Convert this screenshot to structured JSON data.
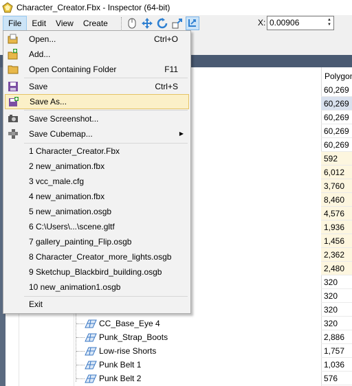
{
  "window": {
    "title": "Character_Creator.Fbx - Inspector (64-bit)"
  },
  "menubar": {
    "items": [
      {
        "label": "File",
        "open": true
      },
      {
        "label": "Edit"
      },
      {
        "label": "View"
      },
      {
        "label": "Create"
      }
    ]
  },
  "toolbar": {
    "x_label": "X:",
    "x_value": "0.00906",
    "icons": [
      "mouse-icon",
      "move-icon",
      "rotate-icon",
      "scale-icon",
      "snap-icon"
    ]
  },
  "file_menu": {
    "items": [
      {
        "label": "Open...",
        "shortcut": "Ctrl+O",
        "icon": "folder-open-icon"
      },
      {
        "label": "Add...",
        "shortcut": "",
        "icon": "add-file-icon"
      },
      {
        "label": "Open Containing Folder",
        "shortcut": "F11",
        "icon": "folder-icon"
      },
      {
        "label": "Save",
        "shortcut": "Ctrl+S",
        "icon": "save-icon"
      },
      {
        "label": "Save As...",
        "shortcut": "",
        "icon": "save-as-icon",
        "highlighted": true
      },
      {
        "label": "Save Screenshot...",
        "shortcut": "",
        "icon": "camera-icon"
      },
      {
        "label": "Save Cubemap...",
        "shortcut": "",
        "icon": "cubemap-icon",
        "submenu": true
      },
      {
        "label": "1 Character_Creator.Fbx"
      },
      {
        "label": "2 new_animation.fbx"
      },
      {
        "label": "3 vcc_male.cfg"
      },
      {
        "label": "4 new_animation.fbx"
      },
      {
        "label": "5 new_animation.osgb"
      },
      {
        "label": "6 C:\\Users\\...\\scene.gltf"
      },
      {
        "label": "7 gallery_painting_Flip.osgb"
      },
      {
        "label": "8 Character_Creator_more_lights.osgb"
      },
      {
        "label": "9 Sketchup_Blackbird_building.osgb"
      },
      {
        "label": "10 new_animation1.osgb"
      },
      {
        "label": "Exit"
      }
    ]
  },
  "table": {
    "polygon_header": "Polygon",
    "polygon_values": [
      "60,269",
      "60,269",
      "60,269",
      "60,269",
      "60,269",
      "592",
      "6,012",
      "3,760",
      "8,460",
      "4,576",
      "1,936",
      "1,456",
      "2,362",
      "2,480",
      "320",
      "320",
      "320",
      "320",
      "2,886",
      "1,757",
      "1,036",
      "576"
    ],
    "visible_nodes": [
      {
        "label": "CC_Base_Eye 4"
      },
      {
        "label": "Punk_Strap_Boots"
      },
      {
        "label": "Low-rise Shorts"
      },
      {
        "label": "Punk Belt 1"
      },
      {
        "label": "Punk Belt 2"
      }
    ]
  },
  "colors": {
    "menu_highlight": "#fbf0c8",
    "selection": "#d9e1ee",
    "dark_band": "#4a5a72"
  }
}
